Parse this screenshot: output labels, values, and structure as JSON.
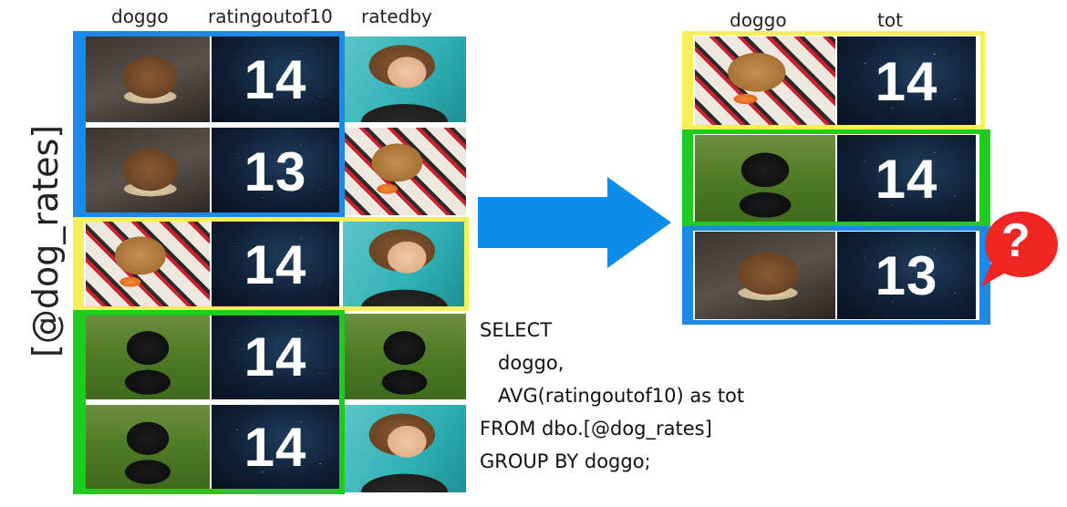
{
  "left_table": {
    "label": "[@dog_rates]",
    "headers": [
      "doggo",
      "ratingoutof10",
      "ratedby"
    ],
    "rows": [
      {
        "dog": "dogA",
        "rating": "14",
        "rater": "person",
        "group": "blue"
      },
      {
        "dog": "dogA",
        "rating": "13",
        "rater": "dogB",
        "group": "blue"
      },
      {
        "dog": "dogB",
        "rating": "14",
        "rater": "person",
        "group": "yellow"
      },
      {
        "dog": "dogC",
        "rating": "14",
        "rater": "dogC",
        "group": "green"
      },
      {
        "dog": "dogC",
        "rating": "14",
        "rater": "person",
        "group": "green"
      }
    ]
  },
  "right_table": {
    "headers": [
      "doggo",
      "tot"
    ],
    "rows": [
      {
        "dog": "dogB",
        "tot": "14",
        "group": "yellow"
      },
      {
        "dog": "dogC",
        "tot": "14",
        "group": "green"
      },
      {
        "dog": "dogA",
        "tot": "13",
        "group": "blue"
      }
    ]
  },
  "sql": {
    "lines": [
      "SELECT",
      "   doggo,",
      "   AVG(ratingoutof10) as tot",
      "FROM dbo.[@dog_rates]",
      "GROUP BY doggo;"
    ]
  },
  "question_mark": "?",
  "colors": {
    "blue": "#1e88e5",
    "yellow": "#f7ef5a",
    "green": "#1fcb1f",
    "arrow": "#0d8de8",
    "bubble": "#f22525"
  }
}
